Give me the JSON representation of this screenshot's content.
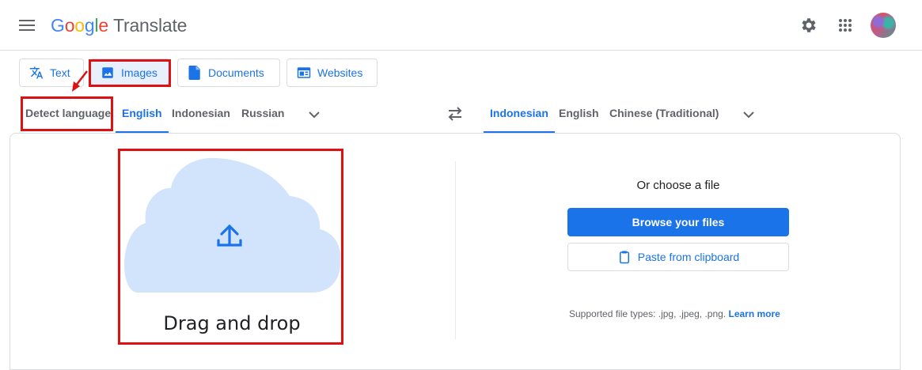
{
  "header": {
    "logo_parts": [
      "G",
      "o",
      "o",
      "g",
      "l",
      "e"
    ],
    "product_name": "Translate",
    "icons": [
      "menu-icon",
      "settings-gear-icon",
      "apps-grid-icon",
      "account-avatar"
    ]
  },
  "modes": {
    "text_label": "Text",
    "images_label": "Images",
    "documents_label": "Documents",
    "websites_label": "Websites",
    "active": "Images"
  },
  "source_langs": {
    "detect": "Detect language",
    "items": [
      "English",
      "Indonesian",
      "Russian"
    ],
    "active": "English"
  },
  "target_langs": {
    "items": [
      "Indonesian",
      "English",
      "Chinese (Traditional)"
    ],
    "active": "Indonesian"
  },
  "upload": {
    "drop_text": "Drag and drop",
    "choose_text": "Or choose a file",
    "browse_label": "Browse your files",
    "paste_label": "Paste from clipboard",
    "supported_text": "Supported file types: .jpg, .jpeg, .png.",
    "learn_more": "Learn more"
  },
  "colors": {
    "accent": "#1a73e8",
    "highlight": "#dd1111",
    "cloud": "#d2e3fc"
  }
}
